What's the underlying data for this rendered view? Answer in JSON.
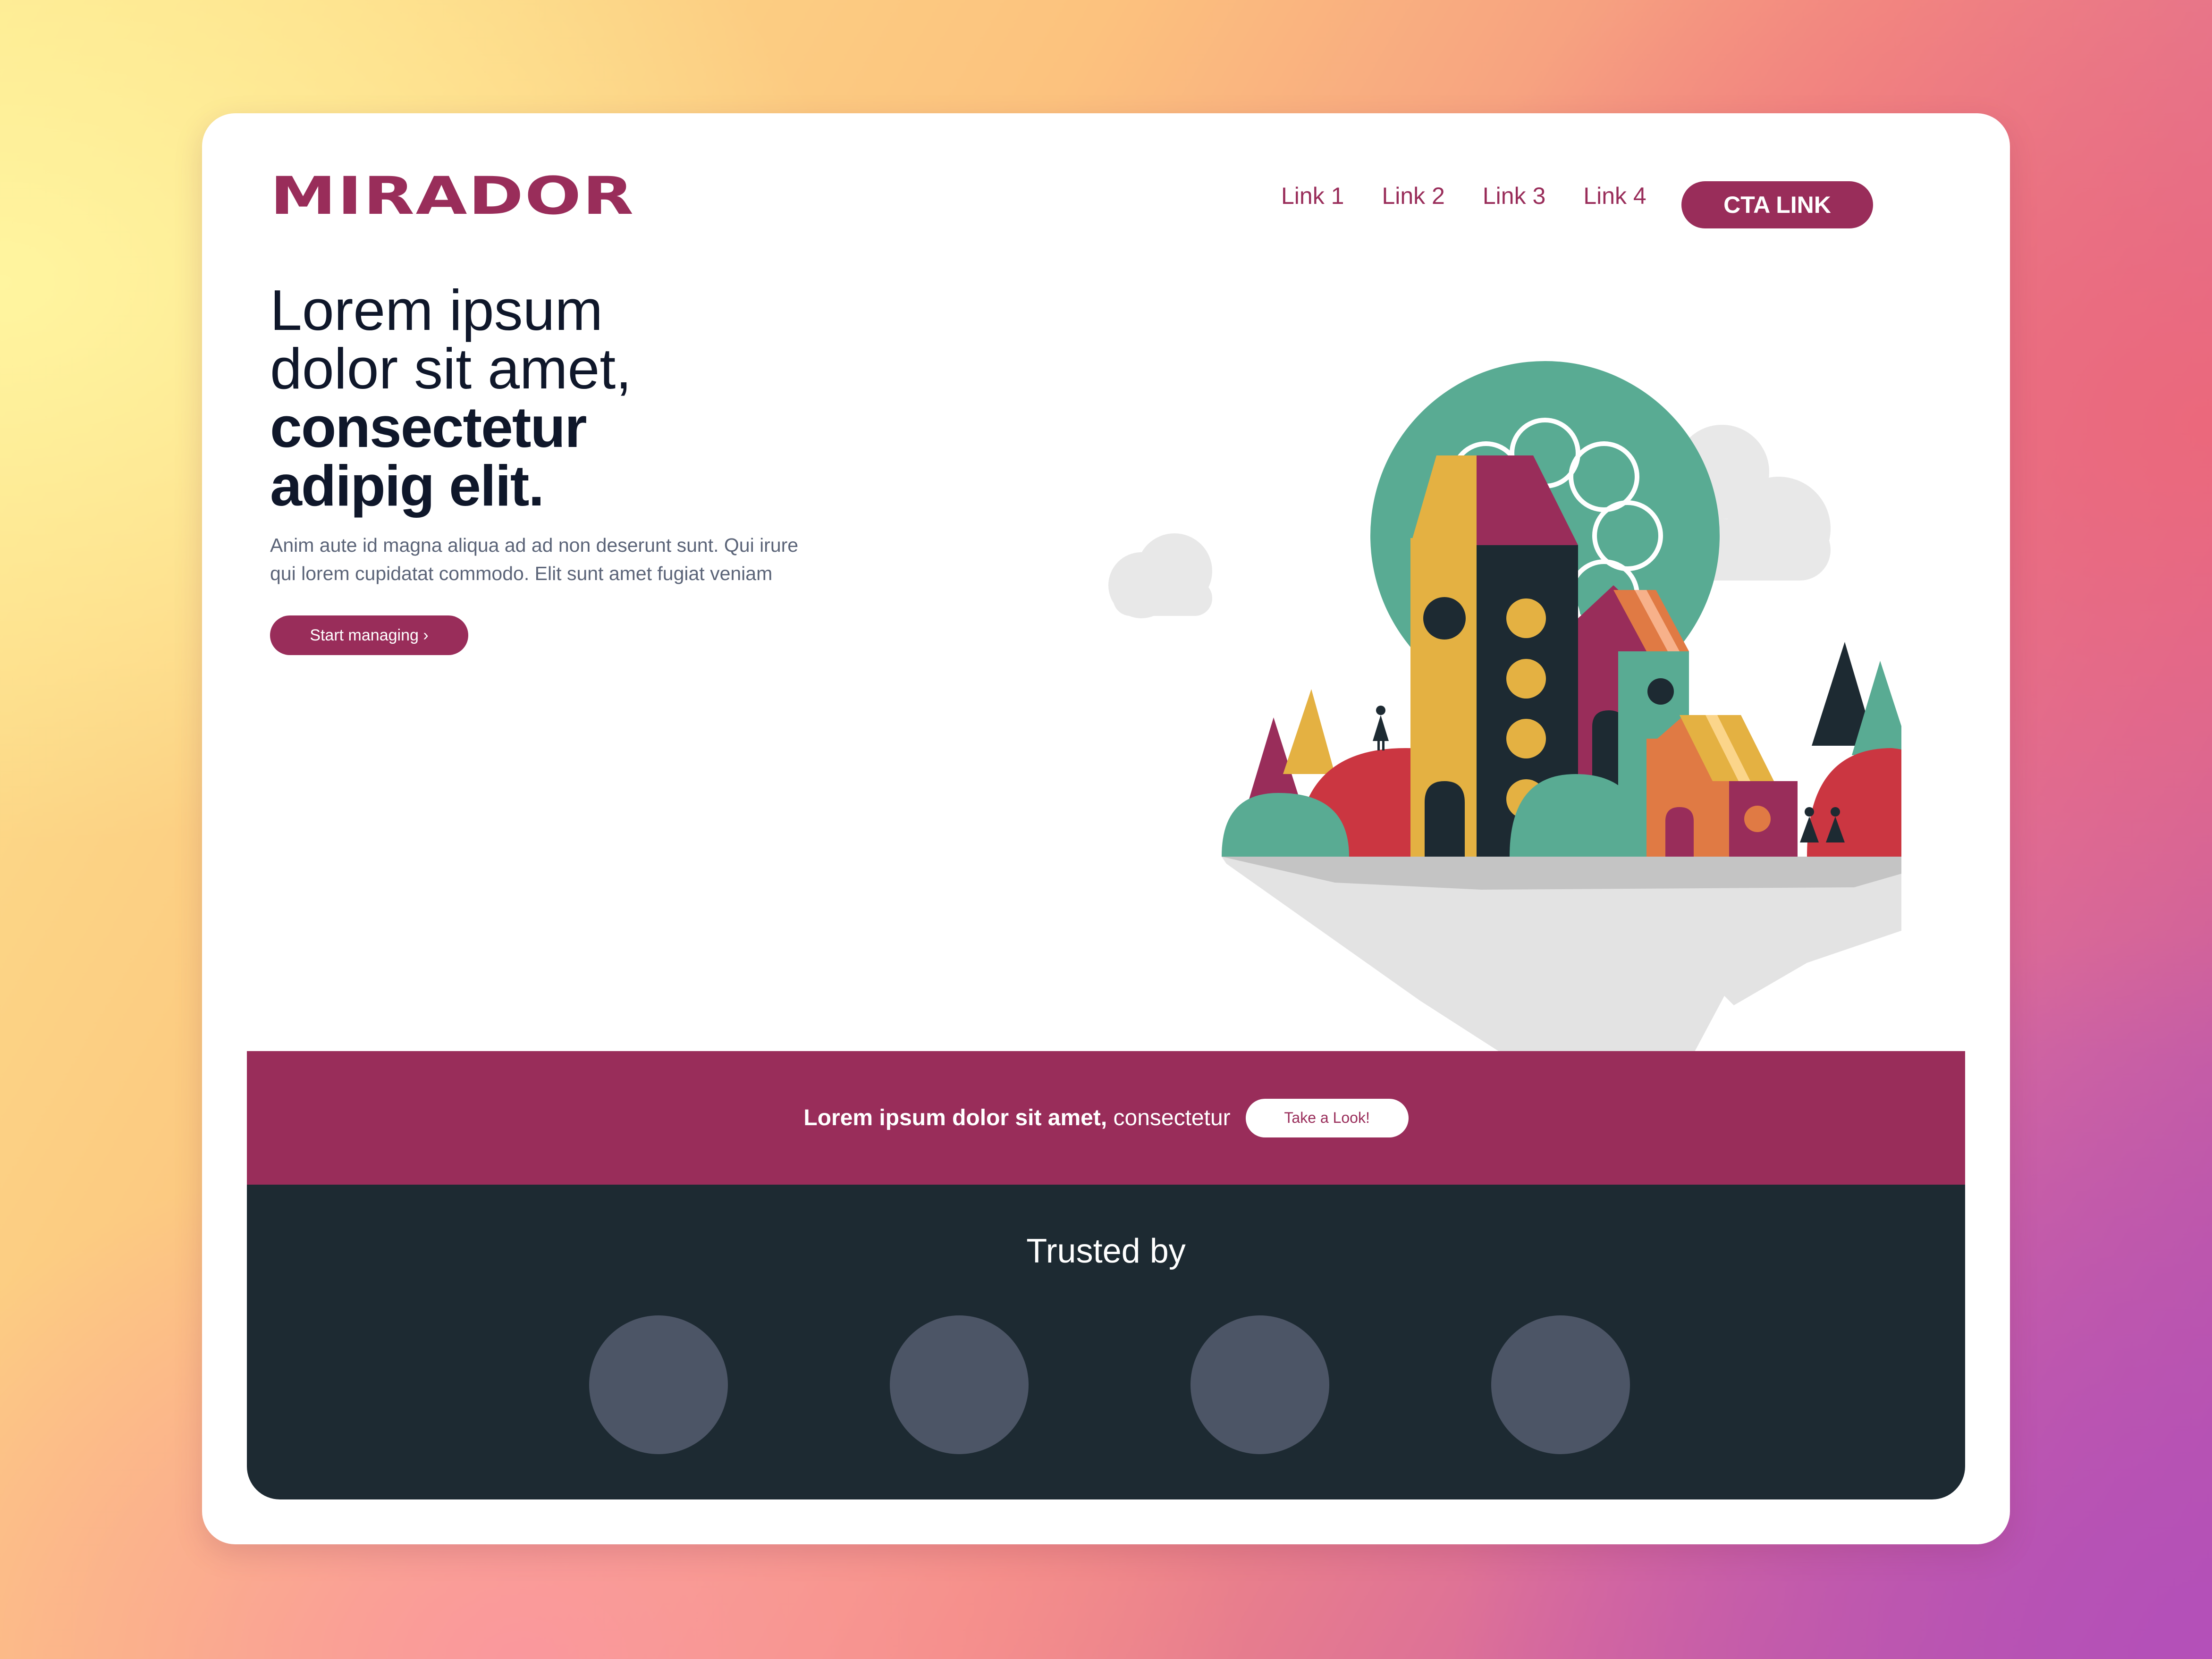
{
  "brand": {
    "name": "MIRADOR",
    "color": "#992d5a"
  },
  "nav": {
    "links": [
      "Link 1",
      "Link 2",
      "Link 3",
      "Link 4"
    ],
    "cta_label": "CTA LINK"
  },
  "hero": {
    "title_line1": "Lorem ipsum",
    "title_line2": "dolor sit amet,",
    "title_line3": "consectetur",
    "title_line4": "adipig elit.",
    "subtitle": "Anim aute id magna aliqua ad ad non deserunt sunt. Qui irure qui lorem cupidatat commodo. Elit sunt amet fugiat veniam",
    "button_label": "Start managing ›"
  },
  "banner": {
    "text_bold": "Lorem ipsum dolor sit amet,",
    "text_regular": " consectetur",
    "button_label": "Take a Look!"
  },
  "trusted": {
    "title": "Trusted by",
    "logo_count": 4
  },
  "colors": {
    "primary": "#992d5a",
    "dark": "#1d2a32",
    "placeholder": "#4c5566",
    "mustard": "#e4b142",
    "teal": "#59ab93",
    "red": "#cb3641"
  }
}
